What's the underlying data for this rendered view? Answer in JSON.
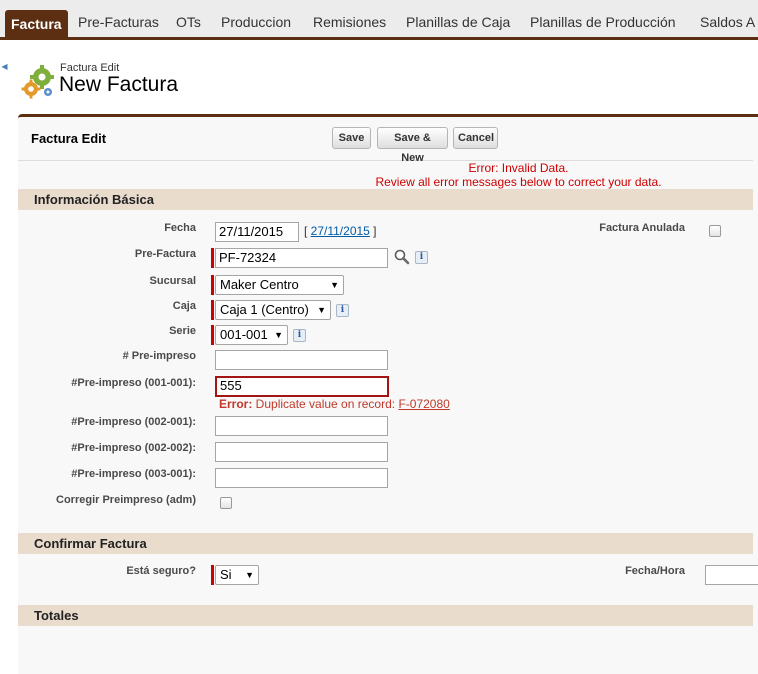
{
  "tabs": [
    "Factura",
    "Pre-Facturas",
    "OTs",
    "Produccion",
    "Remisiones",
    "Planillas de Caja",
    "Planillas de Producción",
    "Saldos A"
  ],
  "header": {
    "subtitle": "Factura Edit",
    "title": "New Factura"
  },
  "panel": {
    "title": "Factura Edit"
  },
  "buttons": {
    "save": "Save",
    "save_new": "Save & New",
    "cancel": "Cancel"
  },
  "errors": {
    "line1": "Error: Invalid Data.",
    "line2": "Review all error messages below to correct your data."
  },
  "sections": {
    "basic": "Información Básica",
    "confirm": "Confirmar Factura",
    "totals": "Totales"
  },
  "fields": {
    "fecha": {
      "label": "Fecha",
      "value": "27/11/2015",
      "link_open": "[ ",
      "link": "27/11/2015",
      "link_close": " ]"
    },
    "pre_factura": {
      "label": "Pre-Factura",
      "value": "PF-72324"
    },
    "sucursal": {
      "label": "Sucursal",
      "value": "Maker Centro"
    },
    "caja": {
      "label": "Caja",
      "value": "Caja 1 (Centro)"
    },
    "serie": {
      "label": "Serie",
      "value": "001-001"
    },
    "pre_impreso": {
      "label": "# Pre-impreso",
      "value": ""
    },
    "pre_impreso_001": {
      "label": "#Pre-impreso (001-001):",
      "value": "555",
      "error_prefix": "Error:",
      "error_text": " Duplicate value on record: ",
      "error_link": "F-072080"
    },
    "pre_impreso_002_001": {
      "label": "#Pre-impreso (002-001):",
      "value": ""
    },
    "pre_impreso_002_002": {
      "label": "#Pre-impreso (002-002):",
      "value": ""
    },
    "pre_impreso_003_001": {
      "label": "#Pre-impreso (003-001):",
      "value": ""
    },
    "corregir": {
      "label": "Corregir Preimpreso (adm)",
      "checked": false
    },
    "factura_anulada": {
      "label": "Factura Anulada",
      "checked": false
    },
    "esta_seguro": {
      "label": "Está seguro?",
      "value": "Si"
    },
    "fecha_hora": {
      "label": "Fecha/Hora",
      "value": ""
    }
  },
  "colors": {
    "brand": "#5c2e12",
    "section_bg": "#e9dccd",
    "error": "#cc0000",
    "link": "#015ba7"
  },
  "icons": {
    "info": "info-icon",
    "lookup": "magnifier-icon",
    "dropdown": "chevron-down-icon",
    "header": "gears-icon"
  }
}
